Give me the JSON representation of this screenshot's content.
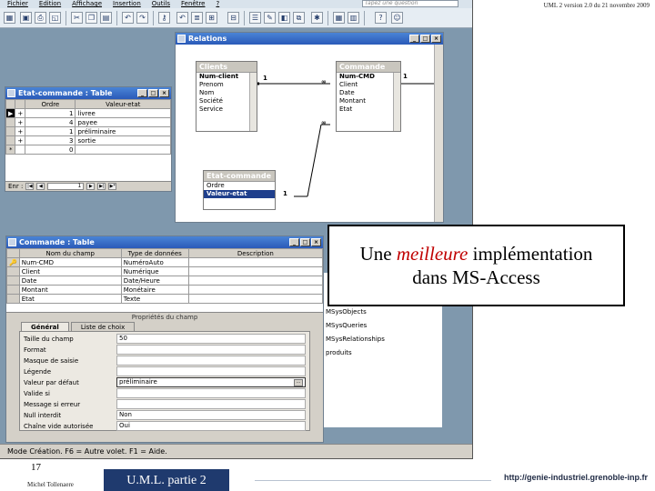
{
  "slide": {
    "header": "UML 2 version 2.0  du  21 novembre 2009",
    "page_number": "17",
    "author": "Michel Tollenaere",
    "footer_title": "U.M.L. partie 2",
    "footer_url": "http://genie-industriel.grenoble-inp.fr"
  },
  "app": {
    "menu": [
      "Fichier",
      "Edition",
      "Affichage",
      "Insertion",
      "Outils",
      "Fenêtre",
      "?"
    ],
    "ask_placeholder": "Tapez une question"
  },
  "relations_window": {
    "title": "Relations",
    "tables": {
      "clients": {
        "title": "Clients",
        "fields": [
          "Num-client",
          "Prenom",
          "Nom",
          "Société",
          "Service"
        ]
      },
      "commande": {
        "title": "Commande",
        "fields": [
          "Num-CMD",
          "Client",
          "Date",
          "Montant",
          "Etat"
        ]
      },
      "etat_commande": {
        "title": "Etat-commande",
        "fields": [
          "Ordre",
          "Valeur-etat"
        ]
      }
    },
    "cardinality_one": "1",
    "cardinality_many": "∞"
  },
  "etat_table_window": {
    "title": "Etat-commande : Table",
    "columns": [
      "Ordre",
      "Valeur-etat"
    ],
    "rows": [
      {
        "marker": "▶",
        "expand": "+",
        "ordre": "1",
        "valeur": "livree"
      },
      {
        "marker": "",
        "expand": "+",
        "ordre": "4",
        "valeur": "payee"
      },
      {
        "marker": "",
        "expand": "+",
        "ordre": "1",
        "valeur": "préliminaire"
      },
      {
        "marker": "",
        "expand": "+",
        "ordre": "3",
        "valeur": "sortie"
      },
      {
        "marker": "*",
        "expand": "",
        "ordre": "0",
        "valeur": ""
      }
    ],
    "nav_label": "Enr :",
    "nav_value": "1"
  },
  "commande_design_window": {
    "title": "Commande : Table",
    "columns": [
      "Nom du champ",
      "Type de données",
      "Description"
    ],
    "rows": [
      {
        "key": "🔑",
        "name": "Num-CMD",
        "type": "NuméroAuto"
      },
      {
        "key": "",
        "name": "Client",
        "type": "Numérique"
      },
      {
        "key": "",
        "name": "Date",
        "type": "Date/Heure"
      },
      {
        "key": "",
        "name": "Montant",
        "type": "Monétaire"
      },
      {
        "key": "",
        "name": "Etat",
        "type": "Texte"
      }
    ],
    "props_header": "Propriétés du champ",
    "tabs": [
      "Général",
      "Liste de choix"
    ],
    "properties": [
      {
        "label": "Taille du champ",
        "value": "50"
      },
      {
        "label": "Format",
        "value": ""
      },
      {
        "label": "Masque de saisie",
        "value": ""
      },
      {
        "label": "Légende",
        "value": ""
      },
      {
        "label": "Valeur par défaut",
        "value": "préliminaire"
      },
      {
        "label": "Valide si",
        "value": ""
      },
      {
        "label": "Message si erreur",
        "value": ""
      },
      {
        "label": "Null interdit",
        "value": "Non"
      },
      {
        "label": "Chaîne vide autorisée",
        "value": "Oui"
      }
    ]
  },
  "objects_list": [
    "MSysObjects",
    "MSysQueries",
    "MSysRelationships",
    "produits"
  ],
  "status_bar": "Mode Création.  F6 = Autre volet.  F1 = Aide.",
  "callout": {
    "line1_before": "Une ",
    "line1_emphasis": "meilleure",
    "line1_after": " implémentation",
    "line2": "dans MS-Access"
  },
  "colors": {
    "accent_emphasis": "#c00000",
    "footer_bar": "#1f3a6e",
    "workspace": "#7f98ad"
  }
}
